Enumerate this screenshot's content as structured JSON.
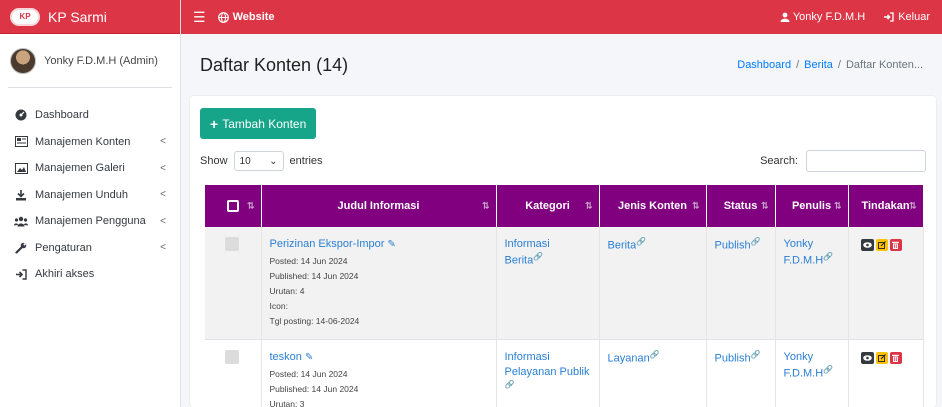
{
  "brand": {
    "logo_text": "KP",
    "name": "KP Sarmi"
  },
  "user_panel": {
    "name": "Yonky F.D.M.H (Admin)"
  },
  "sidebar": {
    "items": [
      {
        "label": "Dashboard",
        "icon": "tachometer-icon",
        "has_caret": false
      },
      {
        "label": "Manajemen Konten",
        "icon": "newspaper-icon",
        "has_caret": true
      },
      {
        "label": "Manajemen Galeri",
        "icon": "image-icon",
        "has_caret": true
      },
      {
        "label": "Manajemen Unduh",
        "icon": "download-icon",
        "has_caret": true
      },
      {
        "label": "Manajemen Pengguna",
        "icon": "users-icon",
        "has_caret": true
      },
      {
        "label": "Pengaturan",
        "icon": "wrench-icon",
        "has_caret": true
      },
      {
        "label": "Akhiri akses",
        "icon": "sign-out-icon",
        "has_caret": false
      }
    ],
    "caret": "<"
  },
  "topbar": {
    "website_label": "Website",
    "user_label": "Yonky F.D.M.H",
    "logout_label": "Keluar"
  },
  "header": {
    "title": "Daftar Konten (14)",
    "breadcrumb": [
      "Dashboard",
      "Berita",
      "Daftar Konten..."
    ]
  },
  "controls": {
    "add_label": "Tambah Konten",
    "show_label": "Show",
    "show_value": "10",
    "entries_label": "entries",
    "search_label": "Search:"
  },
  "table": {
    "columns": [
      "Judul Informasi",
      "Kategori",
      "Jenis Konten",
      "Status",
      "Penulis",
      "Tindakan"
    ],
    "rows": [
      {
        "title": "Perizinan Ekspor-Impor",
        "meta": [
          "Posted: 14 Jun 2024",
          "Published: 14 Jun 2024",
          "Urutan: 4",
          "Icon:",
          "Tgl posting: 14-06-2024"
        ],
        "kategori": "Informasi Berita",
        "jenis": "Berita",
        "status": "Publish",
        "penulis": "Yonky F.D.M.H"
      },
      {
        "title": "teskon",
        "meta": [
          "Posted: 14 Jun 2024",
          "Published: 14 Jun 2024",
          "Urutan: 3"
        ],
        "kategori": "Informasi Pelayanan Publik",
        "jenis": "Layanan",
        "status": "Publish",
        "penulis": "Yonky F.D.M.H"
      }
    ]
  },
  "colors": {
    "accent": "#dc3545",
    "table_header": "#800080",
    "add_button": "#17a589"
  }
}
